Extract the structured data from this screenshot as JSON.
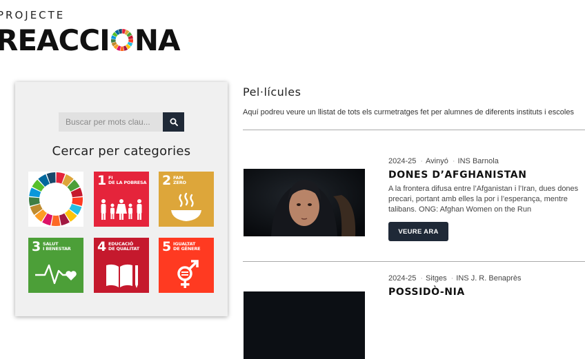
{
  "logo": {
    "top": "PROJECTE",
    "left": "REACCI",
    "right": "NA"
  },
  "sidebar": {
    "search": {
      "placeholder": "Buscar per mots clau..."
    },
    "categories_title": "Cercar per categories",
    "categories": [
      {
        "num": "",
        "label": "",
        "color": "#ffffff",
        "icon": "sdg-wheel-icon"
      },
      {
        "num": "1",
        "label": "FI\nDE LA POBRESA",
        "color": "#e5243b",
        "icon": "family-icon"
      },
      {
        "num": "2",
        "label": "FAM\nZERO",
        "color": "#dda63a",
        "icon": "food-bowl-icon"
      },
      {
        "num": "3",
        "label": "SALUT\nI BENESTAR",
        "color": "#4c9f38",
        "icon": "heartbeat-icon"
      },
      {
        "num": "4",
        "label": "EDUCACIÓ\nDE QUALITAT",
        "color": "#c5192d",
        "icon": "book-pencil-icon"
      },
      {
        "num": "5",
        "label": "IGUALTAT\nDE GÈNERE",
        "color": "#ff3a21",
        "icon": "gender-symbol-icon"
      }
    ]
  },
  "main": {
    "title": "Pel·lícules",
    "description": "Aquí podreu veure un llistat de tots els curmetratges fet per alumnes de diferents instituts i escoles",
    "films": [
      {
        "year": "2024-25",
        "town": "Avinyó",
        "school": "INS Barnola",
        "title": "DONES D’AFGHANISTAN",
        "desc_lines": [
          "A la frontera difusa entre l’Afganistan i l’Iran, dues dones",
          "precari, portant amb elles la por i l’esperança, mentre",
          "talibans. ONG: Afghan Women on the Run"
        ],
        "button": "VEURE ARA"
      },
      {
        "year": "2024-25",
        "town": "Sitges",
        "school": "INS J. R. Benaprès",
        "title": "POSSIDÒ-NIA"
      }
    ]
  }
}
